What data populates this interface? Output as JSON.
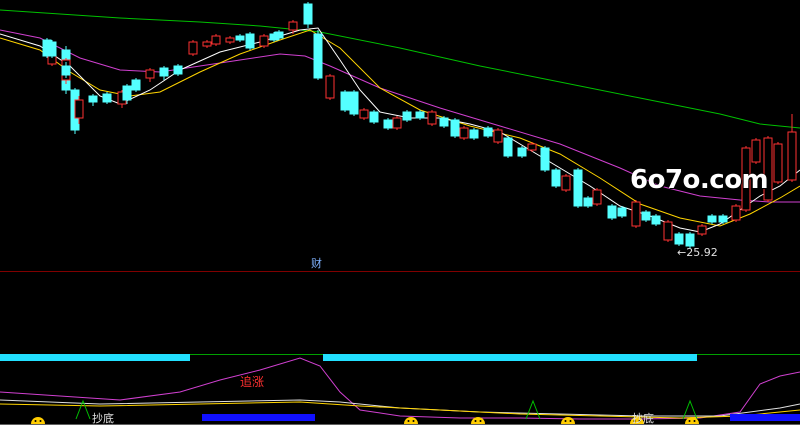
{
  "watermark": "6o7o.com",
  "labels": {
    "cai": "财",
    "low_price": "←25.92",
    "zhui_zhang": "追涨",
    "chao_di_1": "抄底",
    "chao_di_2": "抄底"
  },
  "colors": {
    "up": "#ff3232",
    "down": "#54ffff",
    "ma_white": "#ffffff",
    "ma_yellow": "#ffd400",
    "ma_magenta": "#d040d0",
    "ma_green": "#00c000",
    "divider": "#800000",
    "band_cyan": "#22e0ff",
    "band_blue": "#1010ff",
    "indicator_magenta": "#d040d0",
    "smiley": "#ffcc00"
  },
  "candles": [
    [
      47,
      40,
      56,
      38,
      58
    ],
    [
      52,
      48,
      64,
      46,
      66
    ],
    [
      52,
      42,
      56,
      40,
      58
    ],
    [
      66,
      50,
      90,
      46,
      94
    ],
    [
      66,
      60,
      80,
      58,
      84
    ],
    [
      66,
      66,
      75,
      62,
      78
    ],
    [
      75,
      90,
      130,
      88,
      134
    ],
    [
      79,
      100,
      118,
      96,
      124
    ],
    [
      93,
      96,
      102,
      94,
      106
    ],
    [
      107,
      94,
      102,
      92,
      104
    ],
    [
      122,
      92,
      104,
      90,
      108
    ],
    [
      127,
      86,
      100,
      84,
      104
    ],
    [
      136,
      80,
      90,
      78,
      92
    ],
    [
      150,
      70,
      78,
      68,
      82
    ],
    [
      164,
      68,
      76,
      66,
      80
    ],
    [
      178,
      66,
      74,
      64,
      76
    ],
    [
      193,
      42,
      54,
      40,
      56
    ],
    [
      207,
      42,
      46,
      40,
      48
    ],
    [
      216,
      36,
      44,
      34,
      46
    ],
    [
      230,
      38,
      42,
      36,
      44
    ],
    [
      240,
      36,
      40,
      34,
      42
    ],
    [
      250,
      34,
      48,
      32,
      50
    ],
    [
      264,
      36,
      46,
      34,
      48
    ],
    [
      274,
      34,
      40,
      32,
      42
    ],
    [
      279,
      32,
      38,
      30,
      40
    ],
    [
      293,
      22,
      30,
      20,
      34
    ],
    [
      308,
      4,
      24,
      2,
      28
    ],
    [
      318,
      34,
      78,
      30,
      80
    ],
    [
      330,
      76,
      98,
      74,
      100
    ],
    [
      345,
      92,
      110,
      90,
      112
    ],
    [
      354,
      92,
      114,
      90,
      116
    ],
    [
      364,
      110,
      118,
      108,
      120
    ],
    [
      374,
      112,
      122,
      110,
      124
    ],
    [
      388,
      120,
      128,
      118,
      130
    ],
    [
      397,
      118,
      128,
      116,
      130
    ],
    [
      407,
      112,
      120,
      110,
      122
    ],
    [
      420,
      112,
      118,
      110,
      120
    ],
    [
      432,
      112,
      124,
      110,
      126
    ],
    [
      444,
      118,
      126,
      116,
      128
    ],
    [
      455,
      120,
      136,
      118,
      138
    ],
    [
      464,
      128,
      138,
      126,
      140
    ],
    [
      474,
      130,
      138,
      128,
      140
    ],
    [
      488,
      128,
      136,
      126,
      138
    ],
    [
      498,
      130,
      142,
      128,
      144
    ],
    [
      508,
      138,
      156,
      136,
      158
    ],
    [
      522,
      148,
      156,
      146,
      158
    ],
    [
      532,
      144,
      150,
      142,
      152
    ],
    [
      545,
      148,
      170,
      146,
      172
    ],
    [
      556,
      170,
      186,
      168,
      188
    ],
    [
      566,
      176,
      190,
      174,
      192
    ],
    [
      578,
      170,
      206,
      168,
      208
    ],
    [
      588,
      198,
      206,
      196,
      208
    ],
    [
      597,
      190,
      204,
      188,
      206
    ],
    [
      612,
      206,
      218,
      204,
      220
    ],
    [
      622,
      208,
      216,
      206,
      218
    ],
    [
      636,
      202,
      226,
      200,
      228
    ],
    [
      646,
      212,
      220,
      210,
      222
    ],
    [
      656,
      216,
      224,
      214,
      226
    ],
    [
      668,
      222,
      240,
      220,
      242
    ],
    [
      679,
      234,
      244,
      232,
      246
    ],
    [
      690,
      234,
      246,
      232,
      248
    ],
    [
      702,
      226,
      234,
      224,
      236
    ],
    [
      712,
      216,
      222,
      214,
      224
    ],
    [
      723,
      216,
      222,
      214,
      224
    ],
    [
      736,
      206,
      220,
      204,
      222
    ],
    [
      746,
      148,
      210,
      146,
      212
    ],
    [
      756,
      140,
      162,
      138,
      164
    ],
    [
      768,
      138,
      200,
      136,
      202
    ],
    [
      778,
      144,
      182,
      142,
      184
    ],
    [
      792,
      132,
      180,
      114,
      182
    ]
  ]
}
